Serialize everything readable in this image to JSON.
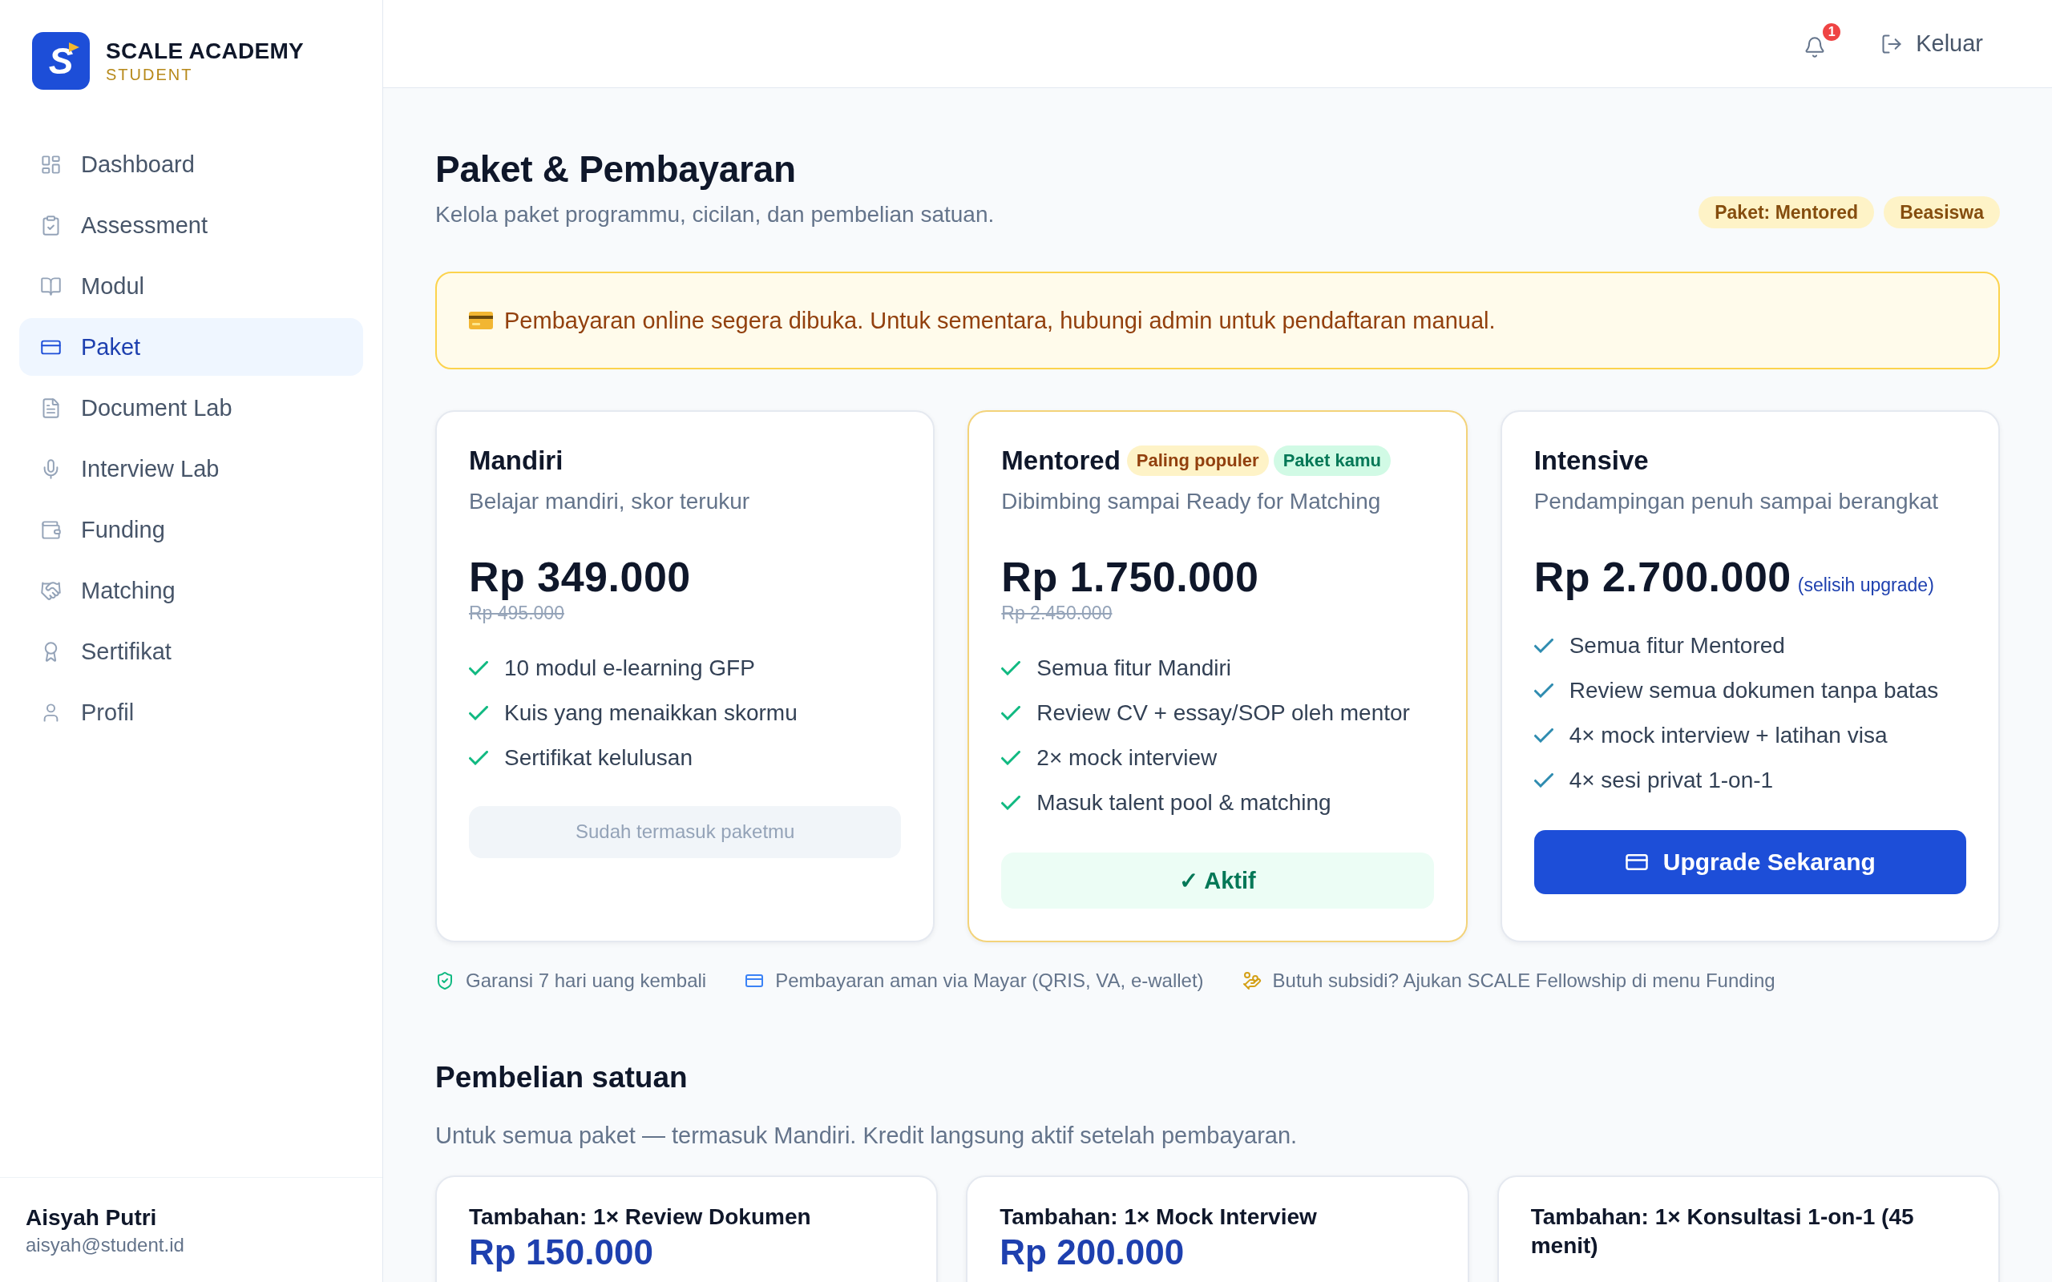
{
  "sidebar": {
    "brand": {
      "logo_letter": "S",
      "name": "SCALE ACADEMY",
      "role": "STUDENT"
    },
    "items": [
      {
        "label": "Dashboard",
        "selected": false
      },
      {
        "label": "Assessment",
        "selected": false
      },
      {
        "label": "Modul",
        "selected": false
      },
      {
        "label": "Paket",
        "selected": true
      },
      {
        "label": "Document Lab",
        "selected": false
      },
      {
        "label": "Interview Lab",
        "selected": false
      },
      {
        "label": "Funding",
        "selected": false
      },
      {
        "label": "Matching",
        "selected": false
      },
      {
        "label": "Sertifikat",
        "selected": false
      },
      {
        "label": "Profil",
        "selected": false
      }
    ],
    "user": {
      "name": "Aisyah Putri",
      "email": "aisyah@student.id"
    }
  },
  "header": {
    "notification_count": "1",
    "logout_label": "Keluar"
  },
  "page": {
    "title": "Paket & Pembayaran",
    "subtitle": "Kelola paket programmu, cicilan, dan pembelian satuan.",
    "badges": [
      "Paket: Mentored",
      "Beasiswa"
    ]
  },
  "notice": {
    "text": "Pembayaran online segera dibuka. Untuk sementara, hubungi admin untuk pendaftaran manual."
  },
  "plans": [
    {
      "name": "Mandiri",
      "highlighted": false,
      "description": "Belajar mandiri, skor terukur",
      "price": "Rp 349.000",
      "old_price": "Rp 495.000",
      "color": "#10b981",
      "features": [
        "10 modul e-learning GFP",
        "Kuis yang menaikkan skormu",
        "Sertifikat kelulusan"
      ],
      "action": {
        "kind": "included",
        "label": "Sudah termasuk paketmu"
      }
    },
    {
      "name": "Mentored",
      "highlighted": true,
      "badges": [
        {
          "label": "Paling populer",
          "kind": "popular"
        },
        {
          "label": "Paket kamu",
          "kind": "current"
        }
      ],
      "description": "Dibimbing sampai Ready for Matching",
      "price": "Rp 1.750.000",
      "old_price": "Rp 2.450.000",
      "color": "#10b981",
      "features": [
        "Semua fitur Mandiri",
        "Review CV + essay/SOP oleh mentor",
        "2× mock interview",
        "Masuk talent pool & matching"
      ],
      "action": {
        "kind": "active",
        "label": "✓ Aktif"
      }
    },
    {
      "name": "Intensive",
      "highlighted": false,
      "description": "Pendampingan penuh sampai berangkat",
      "price": "Rp 2.700.000",
      "price_note": "(selisih upgrade)",
      "color": "#2f8cb0",
      "features": [
        "Semua fitur Mentored",
        "Review semua dokumen tanpa batas",
        "4× mock interview + latihan visa",
        "4× sesi privat 1-on-1"
      ],
      "action": {
        "kind": "upgrade",
        "label": "Upgrade Sekarang"
      }
    }
  ],
  "assurances": [
    "Garansi 7 hari uang kembali",
    "Pembayaran aman via Mayar (QRIS, VA, e-wallet)",
    "Butuh subsidi? Ajukan SCALE Fellowship di menu Funding"
  ],
  "addons": {
    "title": "Pembelian satuan",
    "subtitle": "Untuk semua paket — termasuk Mandiri. Kredit langsung aktif setelah pembayaran.",
    "items": [
      {
        "title": "Tambahan: 1× Review Dokumen",
        "price": "Rp 150.000"
      },
      {
        "title": "Tambahan: 1× Mock Interview",
        "price": "Rp 200.000"
      },
      {
        "title": "Tambahan: 1× Konsultasi 1-on-1 (45 menit)"
      }
    ]
  }
}
